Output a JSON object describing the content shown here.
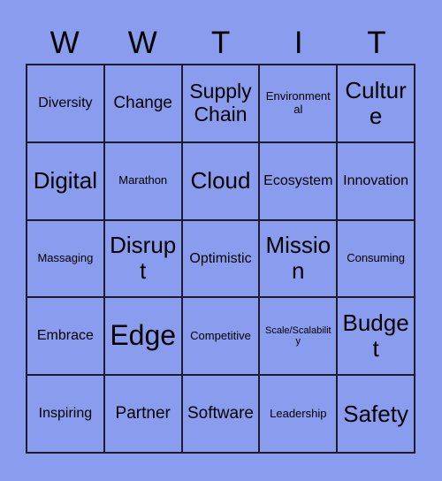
{
  "card": {
    "background_color": "#8a9ced",
    "border_color": "#1d1d2e",
    "text_color": "#000000",
    "header": {
      "letters": [
        "W",
        "W",
        "T",
        "I",
        "T"
      ]
    },
    "grid": {
      "columns": 5,
      "rows": 5,
      "cells": [
        [
          {
            "label": "Diversity",
            "size": "m"
          },
          {
            "label": "Change",
            "size": "l"
          },
          {
            "label": "Supply Chain",
            "size": "xl"
          },
          {
            "label": "Environmental",
            "size": "s"
          },
          {
            "label": "Culture",
            "size": "xxl"
          }
        ],
        [
          {
            "label": "Digital",
            "size": "xxl"
          },
          {
            "label": "Marathon",
            "size": "s"
          },
          {
            "label": "Cloud",
            "size": "xxl"
          },
          {
            "label": "Ecosystem",
            "size": "m"
          },
          {
            "label": "Innovation",
            "size": "m"
          }
        ],
        [
          {
            "label": "Massaging",
            "size": "s"
          },
          {
            "label": "Disrupt",
            "size": "xxl"
          },
          {
            "label": "Optimistic",
            "size": "m"
          },
          {
            "label": "Mission",
            "size": "xxl"
          },
          {
            "label": "Consuming",
            "size": "s"
          }
        ],
        [
          {
            "label": "Embrace",
            "size": "m"
          },
          {
            "label": "Edge",
            "size": "huge"
          },
          {
            "label": "Competitive",
            "size": "s"
          },
          {
            "label": "Scale/Scalability",
            "size": "xs"
          },
          {
            "label": "Budget",
            "size": "xxl"
          }
        ],
        [
          {
            "label": "Inspiring",
            "size": "m"
          },
          {
            "label": "Partner",
            "size": "l"
          },
          {
            "label": "Software",
            "size": "l"
          },
          {
            "label": "Leadership",
            "size": "s"
          },
          {
            "label": "Safety",
            "size": "xxl"
          }
        ]
      ]
    }
  }
}
